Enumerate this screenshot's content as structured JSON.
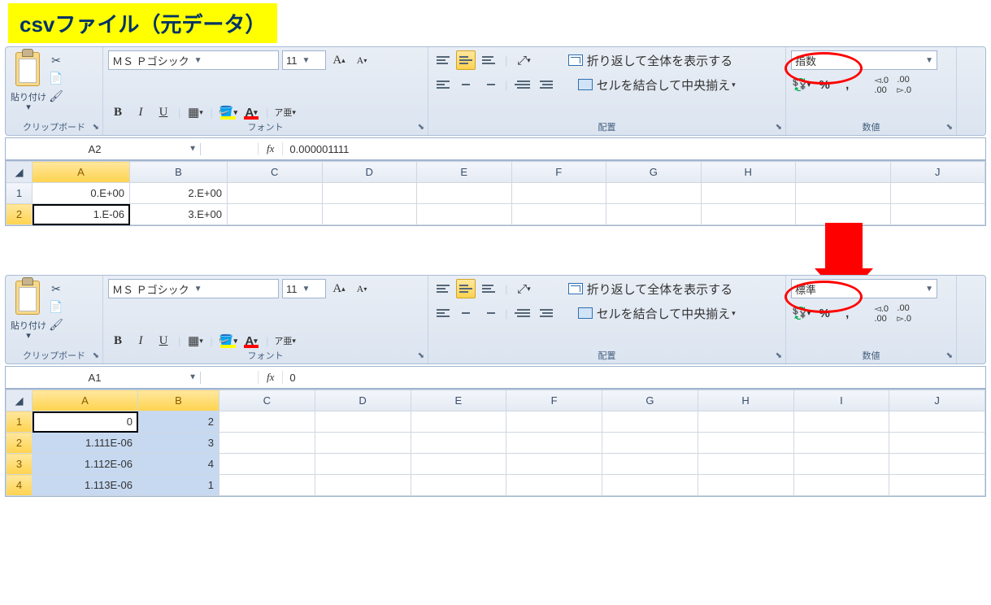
{
  "title": "csvファイル（元データ）",
  "excel_top": {
    "clipboard": {
      "paste_label": "貼り付け",
      "group_label": "クリップボード"
    },
    "font": {
      "name": "ＭＳ Ｐゴシック",
      "size": "11",
      "group_label": "フォント",
      "bold": "B",
      "italic": "I",
      "underline": "U",
      "ruby": "ア亜"
    },
    "alignment": {
      "wrap_text": "折り返して全体を表示する",
      "merge_center": "セルを結合して中央揃え",
      "group_label": "配置"
    },
    "number": {
      "format": "指数",
      "percent": "%",
      "comma": ",",
      "group_label": "数値"
    },
    "name_box": "A2",
    "fx": "fx",
    "formula": "0.000001111",
    "columns": [
      "A",
      "B",
      "C",
      "D",
      "E",
      "F",
      "G",
      "H",
      "",
      "J"
    ],
    "rows": [
      {
        "n": "1",
        "A": "0.E+00",
        "B": "2.E+00"
      },
      {
        "n": "2",
        "A": "1.E-06",
        "B": "3.E+00"
      }
    ],
    "active_cell": "A2"
  },
  "excel_bottom": {
    "clipboard": {
      "paste_label": "貼り付け",
      "group_label": "クリップボード"
    },
    "font": {
      "name": "ＭＳ Ｐゴシック",
      "size": "11",
      "group_label": "フォント",
      "bold": "B",
      "italic": "I",
      "underline": "U",
      "ruby": "ア亜"
    },
    "alignment": {
      "wrap_text": "折り返して全体を表示する",
      "merge_center": "セルを結合して中央揃え",
      "group_label": "配置"
    },
    "number": {
      "format": "標準",
      "percent": "%",
      "comma": ",",
      "group_label": "数値"
    },
    "name_box": "A1",
    "fx": "fx",
    "formula": "0",
    "columns": [
      "A",
      "B",
      "C",
      "D",
      "E",
      "F",
      "G",
      "H",
      "I",
      "J"
    ],
    "rows": [
      {
        "n": "1",
        "A": "0",
        "B": "2"
      },
      {
        "n": "2",
        "A": "1.111E-06",
        "B": "3"
      },
      {
        "n": "3",
        "A": "1.112E-06",
        "B": "4"
      },
      {
        "n": "4",
        "A": "1.113E-06",
        "B": "1"
      }
    ]
  }
}
